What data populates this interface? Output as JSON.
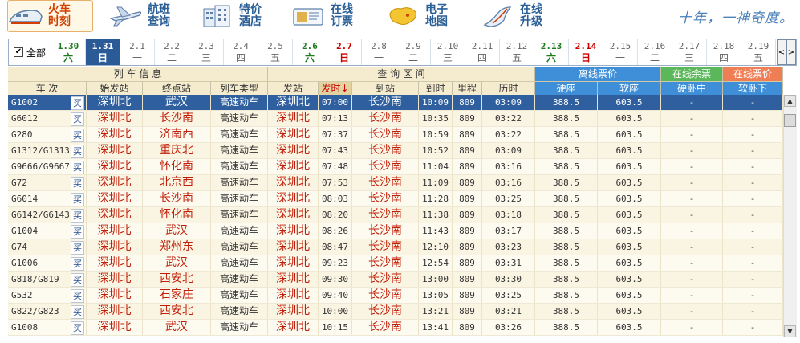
{
  "toolbar": {
    "items": [
      {
        "label1": "火车",
        "label2": "时刻",
        "icon": "train-icon",
        "active": true
      },
      {
        "label1": "航班",
        "label2": "查询",
        "icon": "plane-icon"
      },
      {
        "label1": "特价",
        "label2": "酒店",
        "icon": "hotel-icon"
      },
      {
        "label1": "在线",
        "label2": "订票",
        "icon": "ticket-icon"
      },
      {
        "label1": "电子",
        "label2": "地图",
        "icon": "map-icon"
      },
      {
        "label1": "在线",
        "label2": "升级",
        "icon": "upgrade-icon"
      }
    ],
    "slogan": "十年，一神奇度。"
  },
  "datebar": {
    "all_label": "全部",
    "all_checked": "✔",
    "dates": [
      {
        "d": "1.30",
        "w": "六",
        "type": "sat"
      },
      {
        "d": "1.31",
        "w": "日",
        "type": "sel"
      },
      {
        "d": "2.1",
        "w": "一",
        "type": ""
      },
      {
        "d": "2.2",
        "w": "二",
        "type": ""
      },
      {
        "d": "2.3",
        "w": "三",
        "type": ""
      },
      {
        "d": "2.4",
        "w": "四",
        "type": ""
      },
      {
        "d": "2.5",
        "w": "五",
        "type": ""
      },
      {
        "d": "2.6",
        "w": "六",
        "type": "sat"
      },
      {
        "d": "2.7",
        "w": "日",
        "type": "sun"
      },
      {
        "d": "2.8",
        "w": "一",
        "type": ""
      },
      {
        "d": "2.9",
        "w": "二",
        "type": ""
      },
      {
        "d": "2.10",
        "w": "三",
        "type": ""
      },
      {
        "d": "2.11",
        "w": "四",
        "type": ""
      },
      {
        "d": "2.12",
        "w": "五",
        "type": ""
      },
      {
        "d": "2.13",
        "w": "六",
        "type": "sat"
      },
      {
        "d": "2.14",
        "w": "日",
        "type": "sun"
      },
      {
        "d": "2.15",
        "w": "一",
        "type": ""
      },
      {
        "d": "2.16",
        "w": "二",
        "type": ""
      },
      {
        "d": "2.17",
        "w": "三",
        "type": ""
      },
      {
        "d": "2.18",
        "w": "四",
        "type": ""
      },
      {
        "d": "2.19",
        "w": "五",
        "type": ""
      }
    ],
    "prev": "<",
    "next": ">"
  },
  "table": {
    "group_headers": {
      "train_info": "列 车 信 息",
      "query_range": "查 询 区 间",
      "offline_price": "离线票价",
      "online_remain": "在线余票",
      "online_price": "在线票价"
    },
    "columns": {
      "train_no": "车  次",
      "origin": "始发站",
      "terminal": "终点站",
      "train_type": "列车类型",
      "depart_station": "发站",
      "depart_time": "发时↓",
      "arrive_station": "到站",
      "arrive_time": "到时",
      "distance": "里程",
      "duration": "历时",
      "hard_seat": "硬座",
      "soft_seat": "软座",
      "hard_sleeper_mid": "硬卧中",
      "soft_sleeper_low": "软卧下"
    },
    "buy_label": "买",
    "rows": [
      {
        "no": "G1002",
        "from": "深圳北",
        "to": "武汉",
        "type": "高速动车",
        "dep": "深圳北",
        "dt": "07:00",
        "arr": "长沙南",
        "at": "10:09",
        "km": "809",
        "dur": "03:09",
        "hs": "388.5",
        "ss": "603.5",
        "hsm": "-",
        "ssl": "-"
      },
      {
        "no": "G6012",
        "from": "深圳北",
        "to": "长沙南",
        "type": "高速动车",
        "dep": "深圳北",
        "dt": "07:13",
        "arr": "长沙南",
        "at": "10:35",
        "km": "809",
        "dur": "03:22",
        "hs": "388.5",
        "ss": "603.5",
        "hsm": "-",
        "ssl": "-"
      },
      {
        "no": "G280",
        "from": "深圳北",
        "to": "济南西",
        "type": "高速动车",
        "dep": "深圳北",
        "dt": "07:37",
        "arr": "长沙南",
        "at": "10:59",
        "km": "809",
        "dur": "03:22",
        "hs": "388.5",
        "ss": "603.5",
        "hsm": "-",
        "ssl": "-"
      },
      {
        "no": "G1312/G1313",
        "from": "深圳北",
        "to": "重庆北",
        "type": "高速动车",
        "dep": "深圳北",
        "dt": "07:43",
        "arr": "长沙南",
        "at": "10:52",
        "km": "809",
        "dur": "03:09",
        "hs": "388.5",
        "ss": "603.5",
        "hsm": "-",
        "ssl": "-"
      },
      {
        "no": "G9666/G9667",
        "from": "深圳北",
        "to": "怀化南",
        "type": "高速动车",
        "dep": "深圳北",
        "dt": "07:48",
        "arr": "长沙南",
        "at": "11:04",
        "km": "809",
        "dur": "03:16",
        "hs": "388.5",
        "ss": "603.5",
        "hsm": "-",
        "ssl": "-"
      },
      {
        "no": "G72",
        "from": "深圳北",
        "to": "北京西",
        "type": "高速动车",
        "dep": "深圳北",
        "dt": "07:53",
        "arr": "长沙南",
        "at": "11:09",
        "km": "809",
        "dur": "03:16",
        "hs": "388.5",
        "ss": "603.5",
        "hsm": "-",
        "ssl": "-"
      },
      {
        "no": "G6014",
        "from": "深圳北",
        "to": "长沙南",
        "type": "高速动车",
        "dep": "深圳北",
        "dt": "08:03",
        "arr": "长沙南",
        "at": "11:28",
        "km": "809",
        "dur": "03:25",
        "hs": "388.5",
        "ss": "603.5",
        "hsm": "-",
        "ssl": "-"
      },
      {
        "no": "G6142/G6143",
        "from": "深圳北",
        "to": "怀化南",
        "type": "高速动车",
        "dep": "深圳北",
        "dt": "08:20",
        "arr": "长沙南",
        "at": "11:38",
        "km": "809",
        "dur": "03:18",
        "hs": "388.5",
        "ss": "603.5",
        "hsm": "-",
        "ssl": "-"
      },
      {
        "no": "G1004",
        "from": "深圳北",
        "to": "武汉",
        "type": "高速动车",
        "dep": "深圳北",
        "dt": "08:26",
        "arr": "长沙南",
        "at": "11:43",
        "km": "809",
        "dur": "03:17",
        "hs": "388.5",
        "ss": "603.5",
        "hsm": "-",
        "ssl": "-"
      },
      {
        "no": "G74",
        "from": "深圳北",
        "to": "郑州东",
        "type": "高速动车",
        "dep": "深圳北",
        "dt": "08:47",
        "arr": "长沙南",
        "at": "12:10",
        "km": "809",
        "dur": "03:23",
        "hs": "388.5",
        "ss": "603.5",
        "hsm": "-",
        "ssl": "-"
      },
      {
        "no": "G1006",
        "from": "深圳北",
        "to": "武汉",
        "type": "高速动车",
        "dep": "深圳北",
        "dt": "09:23",
        "arr": "长沙南",
        "at": "12:54",
        "km": "809",
        "dur": "03:31",
        "hs": "388.5",
        "ss": "603.5",
        "hsm": "-",
        "ssl": "-"
      },
      {
        "no": "G818/G819",
        "from": "深圳北",
        "to": "西安北",
        "type": "高速动车",
        "dep": "深圳北",
        "dt": "09:30",
        "arr": "长沙南",
        "at": "13:00",
        "km": "809",
        "dur": "03:30",
        "hs": "388.5",
        "ss": "603.5",
        "hsm": "-",
        "ssl": "-"
      },
      {
        "no": "G532",
        "from": "深圳北",
        "to": "石家庄",
        "type": "高速动车",
        "dep": "深圳北",
        "dt": "09:40",
        "arr": "长沙南",
        "at": "13:05",
        "km": "809",
        "dur": "03:25",
        "hs": "388.5",
        "ss": "603.5",
        "hsm": "-",
        "ssl": "-"
      },
      {
        "no": "G822/G823",
        "from": "深圳北",
        "to": "西安北",
        "type": "高速动车",
        "dep": "深圳北",
        "dt": "10:00",
        "arr": "长沙南",
        "at": "13:21",
        "km": "809",
        "dur": "03:21",
        "hs": "388.5",
        "ss": "603.5",
        "hsm": "-",
        "ssl": "-"
      },
      {
        "no": "G1008",
        "from": "深圳北",
        "to": "武汉",
        "type": "高速动车",
        "dep": "深圳北",
        "dt": "10:15",
        "arr": "长沙南",
        "at": "13:41",
        "km": "809",
        "dur": "03:26",
        "hs": "388.5",
        "ss": "603.5",
        "hsm": "-",
        "ssl": "-"
      }
    ]
  }
}
